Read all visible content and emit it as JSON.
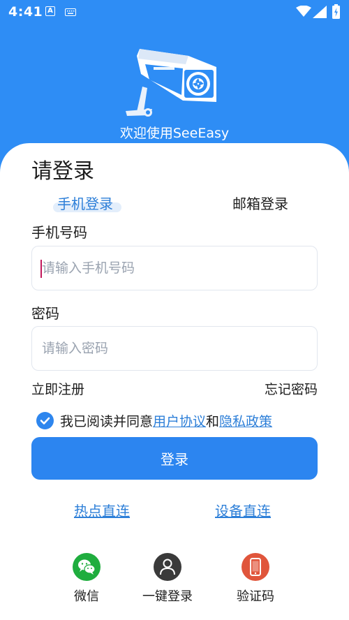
{
  "status_bar": {
    "time": "4:41",
    "a_icon": "A"
  },
  "header": {
    "welcome": "欢迎使用SeeEasy"
  },
  "login": {
    "title": "请登录",
    "tabs": [
      "手机登录",
      "邮箱登录"
    ],
    "phone_label": "手机号码",
    "phone_placeholder": "请输入手机号码",
    "password_label": "密码",
    "password_placeholder": "请输入密码",
    "register": "立即注册",
    "forgot": "忘记密码",
    "agree_prefix": "我已阅读并同意",
    "user_agreement": "用户协议",
    "and": "和",
    "privacy_policy": "隐私政策",
    "login_button": "登录",
    "hotspot_direct": "热点直连",
    "device_direct": "设备直连"
  },
  "alt_login": [
    {
      "label": "微信",
      "icon": "wechat-icon",
      "color": "#1fad3e"
    },
    {
      "label": "一键登录",
      "icon": "user-icon",
      "color": "#3a3a3a"
    },
    {
      "label": "验证码",
      "icon": "phone-icon",
      "color": "#e0553b"
    }
  ],
  "colors": {
    "primary": "#2e8df5",
    "button": "#2c85f0",
    "link": "#2d7fd8"
  }
}
